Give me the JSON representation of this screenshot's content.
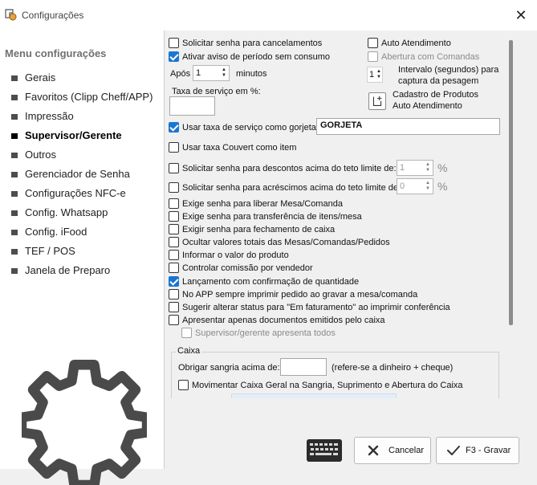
{
  "window": {
    "title": "Configurações",
    "close_glyph": "✕"
  },
  "sidebar": {
    "heading": "Menu configurações",
    "items": [
      {
        "label": "Gerais"
      },
      {
        "label": "Favoritos (Clipp Cheff/APP)"
      },
      {
        "label": "Impressão"
      },
      {
        "label": "Supervisor/Gerente",
        "active": true
      },
      {
        "label": "Outros"
      },
      {
        "label": "Gerenciador de Senha"
      },
      {
        "label": "Configurações NFC-e"
      },
      {
        "label": "Config. Whatsapp"
      },
      {
        "label": "Config. iFood"
      },
      {
        "label": "TEF / POS"
      },
      {
        "label": "Janela de Preparo"
      }
    ]
  },
  "main": {
    "solicitar_senha_cancelamentos": {
      "label": "Solicitar senha para cancelamentos",
      "checked": false
    },
    "ativar_aviso": {
      "label": "Ativar aviso de período sem consumo",
      "checked": true
    },
    "apos": {
      "label": "Após",
      "value": "1",
      "unit": "minutos"
    },
    "taxa_servico": {
      "label": "Taxa de serviço em %:",
      "value": ""
    },
    "auto_atendimento": {
      "label": "Auto Atendimento",
      "checked": false
    },
    "abertura_comandas": {
      "label": "Abertura com Comandas",
      "checked": false
    },
    "intervalo": {
      "value": "1",
      "label_line1": "Intervalo (segundos) para",
      "label_line2": "captura da pesagem"
    },
    "cadastro_produtos": {
      "label_line1": "Cadastro de Produtos",
      "label_line2": "Auto Atendimento"
    },
    "usar_taxa_gorjeta": {
      "label": "Usar taxa de serviço como gorjeta",
      "checked": true,
      "value": "GORJETA"
    },
    "usar_taxa_couvert": {
      "label": "Usar taxa Couvert como item",
      "checked": false
    },
    "senha_descontos": {
      "label": "Solicitar senha para descontos acima do teto limite de:",
      "checked": false,
      "value": "1",
      "unit": "%"
    },
    "senha_acrescimos": {
      "label": "Solicitar senha para acréscimos acima do teto limite de:",
      "checked": false,
      "value": "0",
      "unit": "%"
    },
    "options": [
      {
        "label": "Exige senha para liberar Mesa/Comanda",
        "checked": false
      },
      {
        "label": "Exige senha para transferência de itens/mesa",
        "checked": false
      },
      {
        "label": "Exigir senha para fechamento de caixa",
        "checked": false
      },
      {
        "label": "Ocultar valores totais das Mesas/Comandas/Pedidos",
        "checked": false
      },
      {
        "label": "Informar o valor do produto",
        "checked": false
      },
      {
        "label": "Controlar comissão por vendedor",
        "checked": false
      },
      {
        "label": "Lançamento com confirmação de quantidade",
        "checked": true
      },
      {
        "label": "No APP sempre imprimir pedido ao gravar a mesa/comanda",
        "checked": false
      },
      {
        "label": "Sugerir alterar status para \"Em faturamento\" ao imprimir conferência",
        "checked": false
      },
      {
        "label": "Apresentar apenas documentos emitidos pelo caixa",
        "checked": false
      }
    ],
    "supervisor_todos": {
      "label": "Supervisor/gerente apresenta todos",
      "checked": false
    },
    "caixa": {
      "legend": "Caixa",
      "sangria_label": "Obrigar sangria acima de:",
      "sangria_value": "",
      "sangria_note": "(refere-se a dinheiro  + cheque)",
      "movimentar": {
        "label": "Movimentar Caixa Geral na Sangria, Suprimento e Abertura do Caixa",
        "checked": false
      }
    }
  },
  "footer": {
    "cancel_label": "Cancelar",
    "save_label": "F3 - Gravar"
  },
  "colors": {
    "accent": "#1976d2",
    "cancel_icon": "#333333",
    "save_icon": "#333333"
  },
  "icons": {
    "app": "app-logo-icon",
    "close": "close-icon",
    "gear": "gear-icon",
    "keyboard": "keyboard-icon",
    "cancel": "x-icon",
    "save": "checkmark-icon",
    "add": "add-box-icon"
  }
}
